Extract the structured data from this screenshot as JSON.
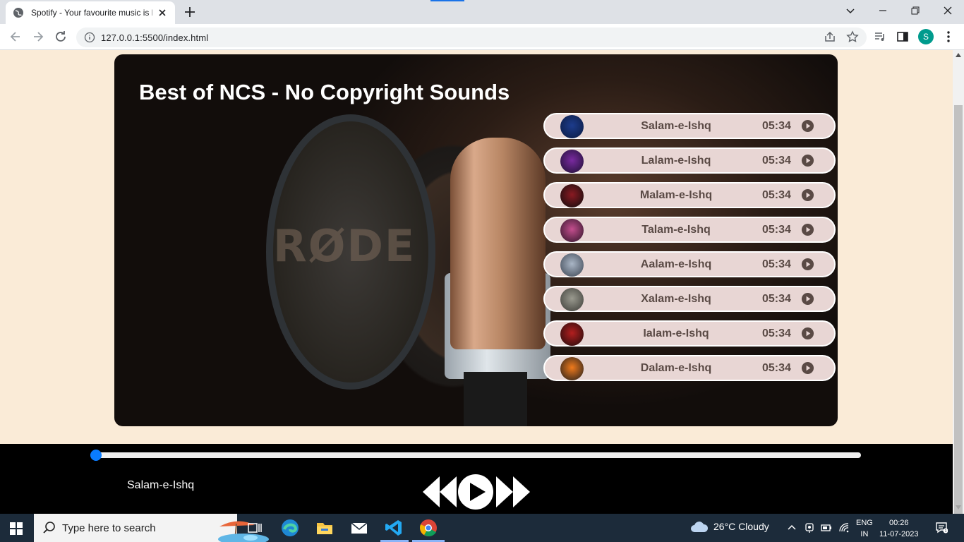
{
  "browser": {
    "tab_title": "Spotify - Your favourite music is here",
    "url": "127.0.0.1:5500/index.html",
    "profile_initial": "S"
  },
  "page": {
    "heading": "Best of NCS - No Copyright Sounds",
    "background_color": "#faebd7"
  },
  "songs": [
    {
      "name": "Salam-e-Ishq",
      "duration": "05:34",
      "thumb_colors": [
        "#1d3c8c",
        "#0a1a3f"
      ]
    },
    {
      "name": "Lalam-e-Ishq",
      "duration": "05:34",
      "thumb_colors": [
        "#7a2aa0",
        "#1b1030"
      ]
    },
    {
      "name": "Malam-e-Ishq",
      "duration": "05:34",
      "thumb_colors": [
        "#8a1a22",
        "#0c0c0c"
      ]
    },
    {
      "name": "Talam-e-Ishq",
      "duration": "05:34",
      "thumb_colors": [
        "#c44e8e",
        "#2a1426"
      ]
    },
    {
      "name": "Aalam-e-Ishq",
      "duration": "05:34",
      "thumb_colors": [
        "#aab6c6",
        "#3a4350"
      ]
    },
    {
      "name": "Xalam-e-Ishq",
      "duration": "05:34",
      "thumb_colors": [
        "#9a9a8f",
        "#3b3b36"
      ]
    },
    {
      "name": "Ialam-e-Ishq",
      "duration": "05:34",
      "thumb_colors": [
        "#b31f1f",
        "#1c0b0b"
      ]
    },
    {
      "name": "Dalam-e-Ishq",
      "duration": "05:34",
      "thumb_colors": [
        "#f07a1c",
        "#1c1c1c"
      ]
    }
  ],
  "player": {
    "now_playing": "Salam-e-Ishq",
    "progress_percent": 0,
    "controls": [
      "previous-icon",
      "play-icon",
      "next-icon"
    ]
  },
  "taskbar": {
    "search_placeholder": "Type here to search",
    "weather": "26°C  Cloudy",
    "lang_line1": "ENG",
    "lang_line2": "IN",
    "time": "00:26",
    "date": "11-07-2023"
  }
}
